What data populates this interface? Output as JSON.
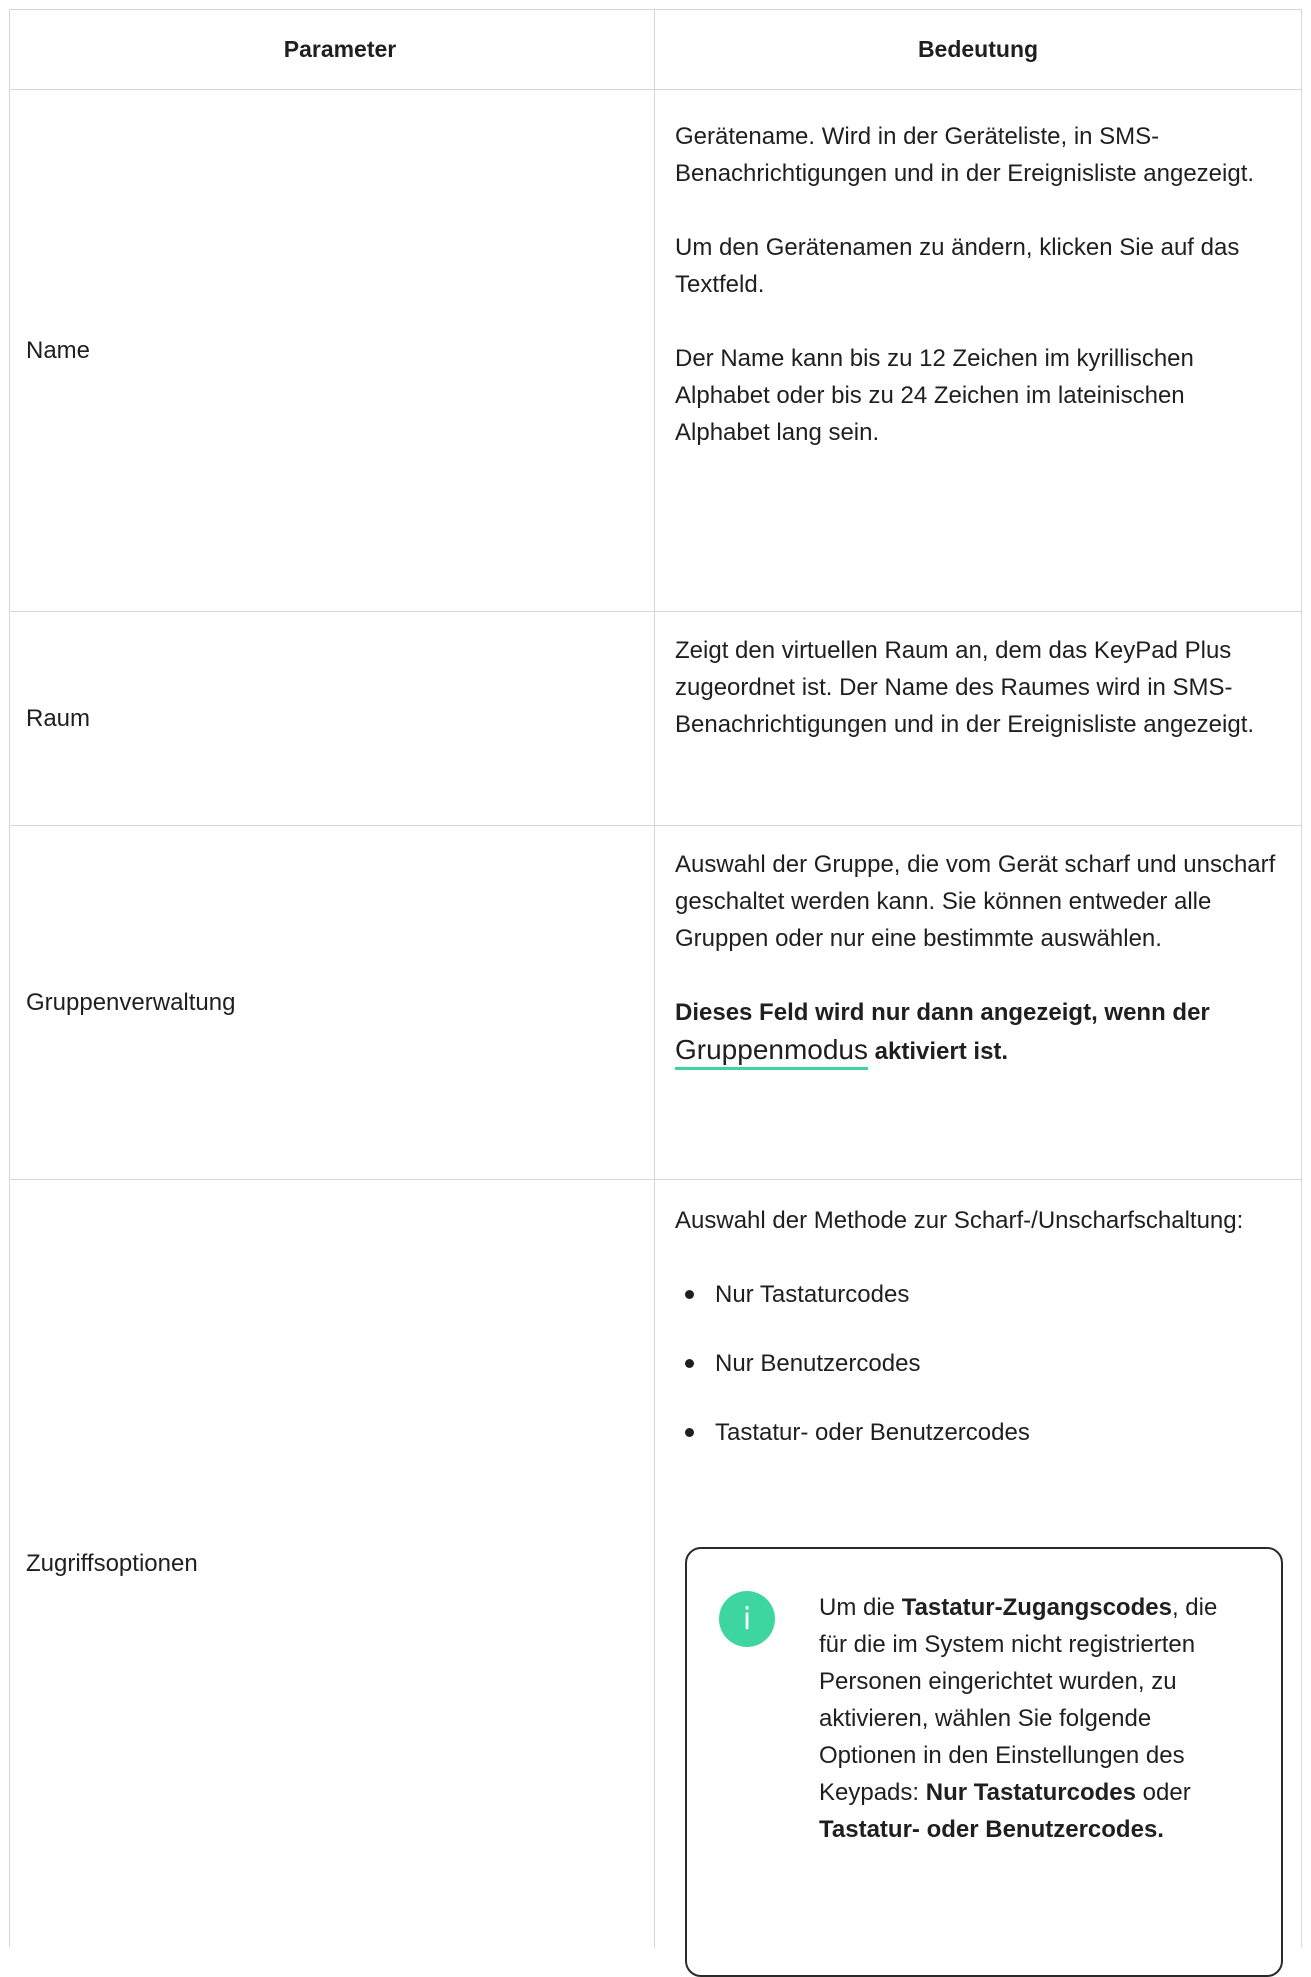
{
  "table": {
    "headers": {
      "parameter": "Parameter",
      "meaning": "Bedeutung"
    },
    "rows": {
      "name": {
        "label": "Name",
        "p1": "Gerätename. Wird in der Geräteliste, in SMS-Benachrichtigungen und in der Ereignisliste angezeigt.",
        "p2": "Um den Gerätenamen zu ändern, klicken Sie auf das Textfeld.",
        "p3": "Der Name kann bis zu 12 Zeichen im kyrillischen Alphabet oder bis zu 24 Zeichen im lateinischen Alphabet lang sein."
      },
      "raum": {
        "label": "Raum",
        "p1": "Zeigt den virtuellen Raum an, dem das KeyPad Plus zugeordnet ist. Der Name des Raumes wird in SMS-Benachrichtigungen und in der Ereignisliste angezeigt."
      },
      "gruppen": {
        "label": "Gruppenverwaltung",
        "p1": "Auswahl der Gruppe, die vom Gerät scharf und unscharf geschaltet werden kann. Sie können entweder alle Gruppen oder nur eine bestimmte auswählen.",
        "note_before": "Dieses Feld wird nur dann angezeigt, wenn der ",
        "note_link": "Gruppenmodus",
        "note_after": " aktiviert ist."
      },
      "zugriff": {
        "label": "Zugriffsoptionen",
        "intro": "Auswahl der Methode zur Scharf-/Unscharfschaltung:",
        "options": [
          "Nur Tastaturcodes",
          "Nur Benutzercodes",
          "Tastatur- oder Benutzercodes"
        ],
        "info": {
          "icon": "info-icon",
          "t1": "Um die ",
          "b1": "Tastatur-Zugangscodes",
          "t2": ", die für die im System nicht registrierten Personen eingerichtet wurden, zu aktivieren, wählen Sie folgende Optionen in den Einstellungen des Keypads: ",
          "b2": "Nur Tastaturcodes",
          "t3": " oder ",
          "b3": "Tastatur- oder Benutzercodes."
        }
      }
    }
  },
  "colors": {
    "accent": "#3ed6a0",
    "border": "#d6d6d6",
    "text": "#1f1f1f"
  }
}
